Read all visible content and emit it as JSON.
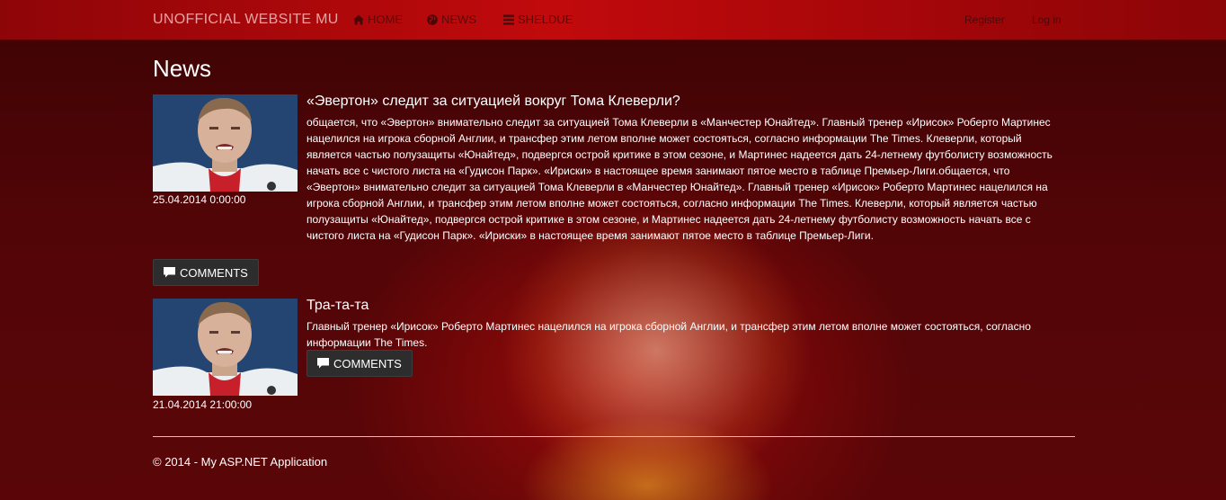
{
  "navbar": {
    "brand": "UNOFFICIAL WEBSITE MU",
    "links": [
      {
        "label": "HOME",
        "icon": "home-icon"
      },
      {
        "label": "NEWS",
        "icon": "globe-icon"
      },
      {
        "label": "SHELDUE",
        "icon": "list-icon"
      }
    ],
    "register": "Register",
    "login": "Log in"
  },
  "page": {
    "title": "News"
  },
  "news": [
    {
      "title": "«Эвертон» следит за ситуацией вокруг Тома Клеверли?",
      "body": "общается, что «Эвертон» внимательно следит за ситуацией Тома Клеверли в «Манчестер Юнайтед». Главный тренер «Ирисок» Роберто Мартинес нацелился на игрока сборной Англии, и трансфер этим летом вполне может состояться, согласно информации The Times. Клеверли, который является частью полузащиты «Юнайтед», подвергся острой критике в этом сезоне, и Мартинес надеется дать 24-летнему футболисту возможность начать все с чистого листа на «Гудисон Парк». «Ириски» в настоящее время занимают пятое место в таблице Премьер-Лиги.общается, что «Эвертон» внимательно следит за ситуацией Тома Клеверли в «Манчестер Юнайтед». Главный тренер «Ирисок» Роберто Мартинес нацелился на игрока сборной Англии, и трансфер этим летом вполне может состояться, согласно информации The Times. Клеверли, который является частью полузащиты «Юнайтед», подвергся острой критике в этом сезоне, и Мартинес надеется дать 24-летнему футболисту возможность начать все с чистого листа на «Гудисон Парк». «Ириски» в настоящее время занимают пятое место в таблице Премьер-Лиги.",
      "date": "25.04.2014 0:00:00",
      "comments_label": "COMMENTS"
    },
    {
      "title": "Тра-та-та",
      "body": "Главный тренер «Ирисок» Роберто Мартинес нацелился на игрока сборной Англии, и трансфер этим летом вполне может состояться, согласно информации The Times.",
      "date": "21.04.2014 21:00:00",
      "comments_label": "COMMENTS"
    }
  ],
  "footer": {
    "text": "© 2014 - My ASP.NET Application"
  }
}
